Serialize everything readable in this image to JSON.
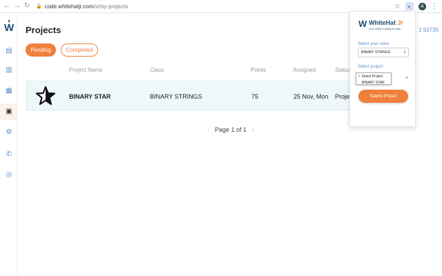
{
  "browser": {
    "url_host": "code.whitehatjr.com",
    "url_path": "/s/my-projects",
    "account_initial": "A"
  },
  "sidebar": {
    "items": [
      "dashboard-icon",
      "book-icon",
      "calendar-icon",
      "projects-icon",
      "settings-icon",
      "phone-icon",
      "help-icon"
    ]
  },
  "page": {
    "title": "Projects",
    "phone_fragment": "1 93735"
  },
  "tabs": [
    {
      "label": "Pending",
      "active": true
    },
    {
      "label": "Completed",
      "active": false
    }
  ],
  "table": {
    "headers": [
      "Project Name",
      "Class",
      "Points",
      "Assigned",
      "Status"
    ],
    "rows": [
      {
        "project_name": "BINARY STAR",
        "class": "BINARY STRINGS",
        "points": "75",
        "assigned": "25 Nov, Mon",
        "status": "Proje"
      }
    ]
  },
  "pagination": {
    "text": "Page 1 of 1"
  },
  "popup": {
    "brand_name": "WhiteHat",
    "brand_suffix": "Jr",
    "tagline": "Live online coding for kids",
    "class_label": "Select your class",
    "class_value": "BINARY STRINGS",
    "project_label": "Select project",
    "project_options": [
      "Select Project",
      "BINARY STAR"
    ],
    "submit_label": "Submit Project"
  },
  "colors": {
    "accent": "#f07f3c",
    "brand_blue": "#1f4e79",
    "link_blue": "#5a8fc7",
    "row_bg": "#eef8fb"
  }
}
